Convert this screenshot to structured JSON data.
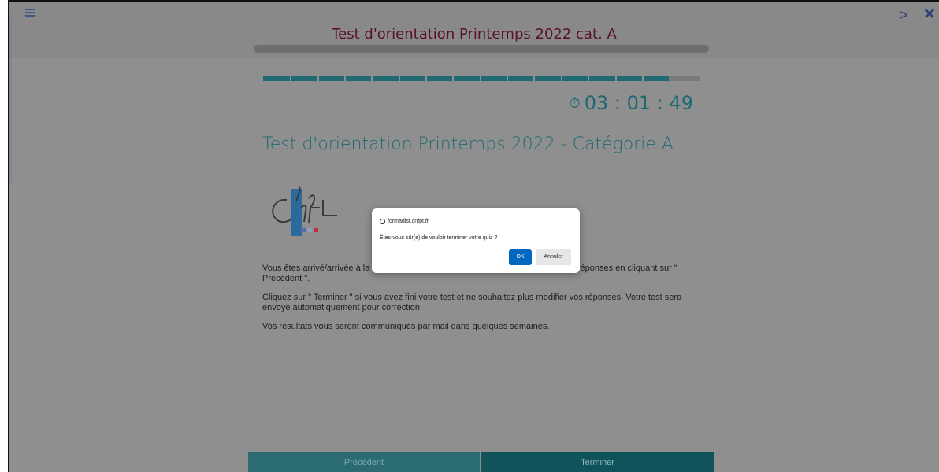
{
  "header": {
    "title": "Test d'orientation Printemps 2022 cat. A",
    "menu_icon": "hamburger-menu-icon",
    "next_label": ">",
    "close_label": "✕"
  },
  "progress": {
    "fraction": 0.93,
    "segments": 15
  },
  "timer": {
    "icon": "stopwatch-icon",
    "value": "03 : 01 : 49"
  },
  "page": {
    "title": "Test d'orientation Printemps 2022 - Catégorie A",
    "logo_text": "le cnfpt",
    "paragraphs": [
      "Vous êtes arrivé/arrivée à la dernière page du test. Vous pouvez encore relire vos réponses en cliquant sur \" Précédent \".",
      "Cliquez sur \" Terminer \" si vous avez fini votre test et ne souhaitez plus modifier vos réponses. Votre test sera envoyé automatiquement pour correction.",
      "Vos résultats vous seront communiqués par mail dans quelques semaines."
    ]
  },
  "footer": {
    "prev_label": "Précédent",
    "finish_label": "Terminer"
  },
  "dialog": {
    "origin": "formadist.cnfpt.fr",
    "message": "Êtes-vous sûr(e) de vouloir terminer votre quiz ?",
    "ok_label": "OK",
    "cancel_label": "Annuler"
  },
  "colors": {
    "accent": "#1f6a72",
    "header_title": "#5a0f2e",
    "dialog_ok": "#0067c0"
  }
}
